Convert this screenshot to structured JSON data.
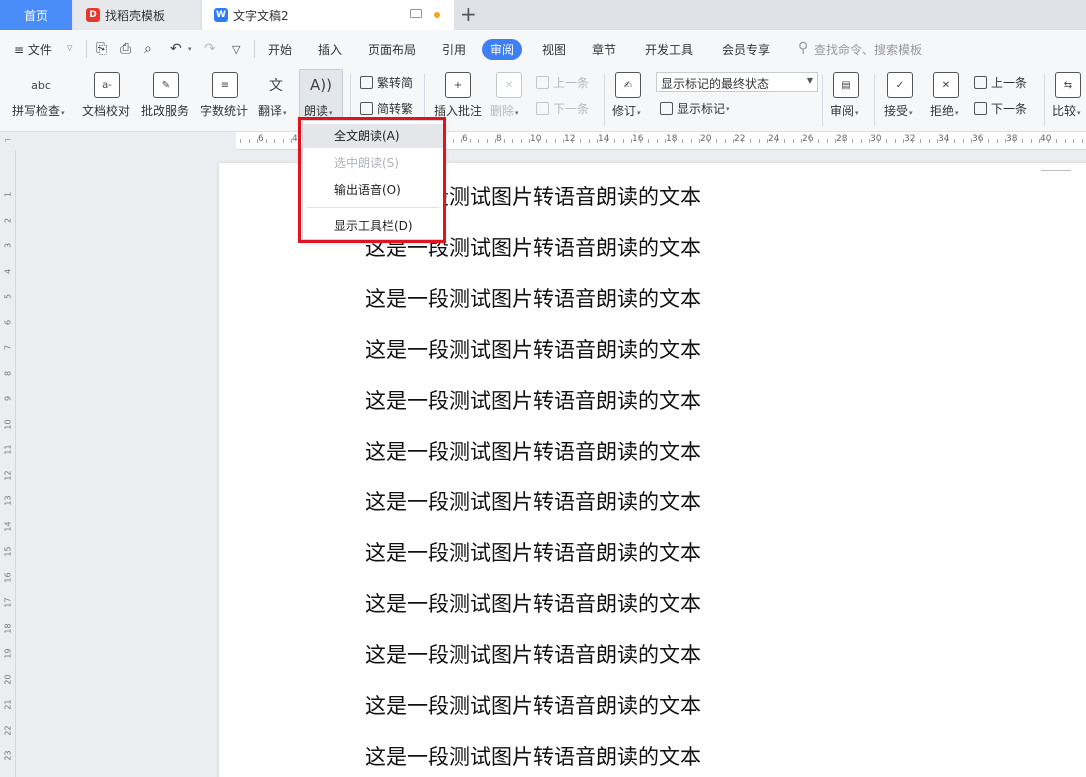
{
  "tabs": {
    "home": "首页",
    "template": "找稻壳模板",
    "document": "文字文稿2",
    "template_icon_text": "D",
    "document_icon_text": "W",
    "new_tab": "+"
  },
  "menubar": {
    "file": "≡ 文件",
    "items": [
      "开始",
      "插入",
      "页面布局",
      "引用",
      "审阅",
      "视图",
      "章节",
      "开发工具",
      "会员专享"
    ],
    "active": "审阅",
    "search": "查找命令、搜索模板"
  },
  "ribbon": {
    "spell_check": "拼写检查",
    "doc_proofread": "文档校对",
    "revision_service": "批改服务",
    "word_count": "字数统计",
    "translate": "翻译",
    "read_aloud": "朗读",
    "trad_to_simp": "繁转简",
    "simp_to_trad": "简转繁",
    "insert_comment": "插入批注",
    "delete": "删除",
    "prev_comment": "上一条",
    "next_comment": "下一条",
    "track_changes": "修订",
    "markup_combo": "显示标记的最终状态",
    "show_markup": "显示标记",
    "review": "审阅",
    "accept": "接受",
    "reject": "拒绝",
    "prev_change": "上一条",
    "next_change": "下一条",
    "compare": "比较",
    "icon_abc": "abc"
  },
  "dropdown": {
    "items": [
      {
        "label": "全文朗读(A)",
        "state": "hover"
      },
      {
        "label": "选中朗读(S)",
        "state": "disabled"
      },
      {
        "label": "输出语音(O)",
        "state": "normal"
      },
      {
        "label": "显示工具栏(D)",
        "state": "normal"
      }
    ]
  },
  "ruler": {
    "corner": "⌐",
    "labels": [
      "6",
      "4",
      "6",
      "8",
      "10",
      "12",
      "14",
      "16",
      "18",
      "20",
      "22",
      "24",
      "26",
      "28",
      "30",
      "32",
      "34",
      "36",
      "38",
      "40"
    ],
    "vertical": [
      "1",
      "2",
      "3",
      "4",
      "5",
      "6",
      "7",
      "8",
      "9",
      "10",
      "11",
      "12",
      "13",
      "14",
      "15",
      "16",
      "17",
      "18",
      "19",
      "20",
      "21",
      "22",
      "23"
    ]
  },
  "document": {
    "lines": [
      "这是一段测试图片转语音朗读的文本",
      "这是一段测试图片转语音朗读的文本",
      "这是一段测试图片转语音朗读的文本",
      "这是一段测试图片转语音朗读的文本",
      "这是一段测试图片转语音朗读的文本",
      "这是一段测试图片转语音朗读的文本",
      "这是一段测试图片转语音朗读的文本",
      "这是一段测试图片转语音朗读的文本",
      "这是一段测试图片转语音朗读的文本",
      "这是一段测试图片转语音朗读的文本",
      "这是一段测试图片转语音朗读的文本",
      "这是一段测试图片转语音朗读的文本"
    ]
  },
  "colors": {
    "accent": "#3f7ff5",
    "highlight": "#e0141f",
    "home_tab": "#4a8cf7"
  }
}
